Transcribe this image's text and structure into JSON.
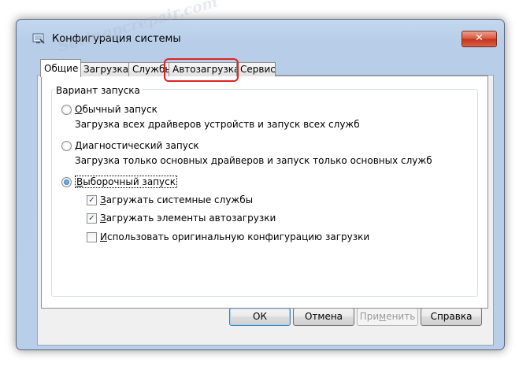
{
  "window": {
    "title": "Конфигурация системы",
    "close_glyph": "✕",
    "app_icon": "msconfig-icon"
  },
  "tabs": [
    {
      "label": "Общие",
      "active": true
    },
    {
      "label": "Загрузка",
      "active": false
    },
    {
      "label": "Службы",
      "active": false
    },
    {
      "label": "Автозагрузка",
      "active": false,
      "highlighted": true
    },
    {
      "label": "Сервис",
      "active": false
    }
  ],
  "startup_group": {
    "legend": "Вариант запуска",
    "options": [
      {
        "label_key": "О",
        "label_rest": "бычный запуск",
        "description": "Загрузка всех драйверов устройств и запуск всех служб",
        "checked": false
      },
      {
        "label_key": "Д",
        "label_rest": "иагностический запуск",
        "description": "Загрузка только основных драйверов и запуск только основных служб",
        "checked": false
      },
      {
        "label_key": "В",
        "label_rest": "ыборочный запуск",
        "checked": true
      }
    ],
    "checkboxes": [
      {
        "label_key": "З",
        "label_rest": "агружать системные службы",
        "checked": true
      },
      {
        "label_key": "З",
        "label_rest": "агружать элементы автозагрузки",
        "checked": true
      },
      {
        "label_key": "И",
        "label_rest": "спользовать оригинальную конфигурацию загрузки",
        "checked": false
      }
    ]
  },
  "buttons": {
    "ok": "ОК",
    "cancel": "Отмена",
    "apply_pre": "При",
    "apply_key": "м",
    "apply_post": "енить",
    "help": "Справка"
  },
  "watermark": "Soringpcrepair.com",
  "colors": {
    "highlight_outline": "#e02222",
    "title_bar": "#b9cfe9",
    "close_button": "#c4331b"
  }
}
